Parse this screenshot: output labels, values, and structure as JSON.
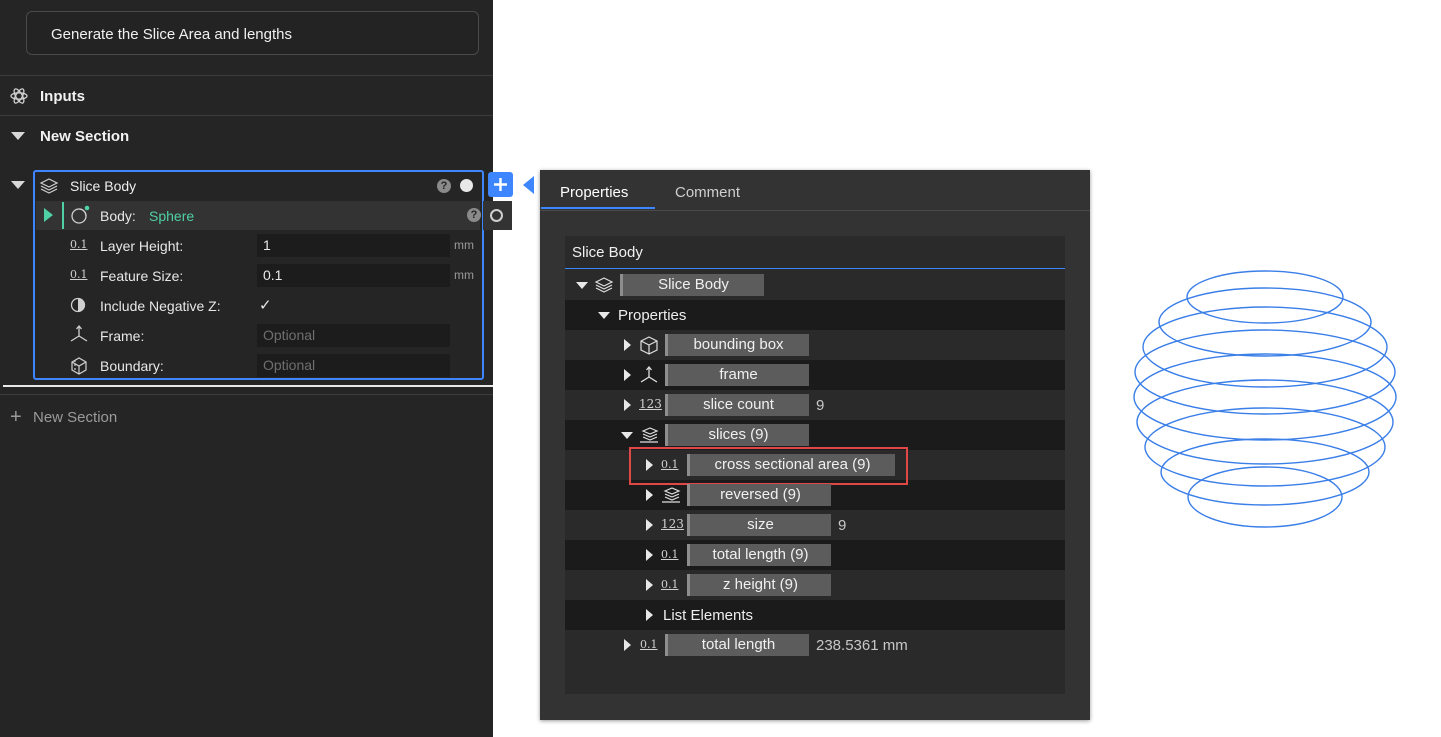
{
  "left_panel": {
    "task_title": "Generate the Slice Area and lengths",
    "inputs_label": "Inputs",
    "section_label": "New Section",
    "add_section_label": "New Section",
    "node": {
      "title": "Slice Body",
      "body_label": "Body:",
      "body_value": "Sphere",
      "fields": [
        {
          "label": "Layer Height:",
          "value": "1",
          "unit": "mm"
        },
        {
          "label": "Feature Size:",
          "value": "0.1",
          "unit": "mm"
        },
        {
          "label": "Include Negative Z:",
          "checked": true
        },
        {
          "label": "Frame:",
          "placeholder": "Optional"
        },
        {
          "label": "Boundary:",
          "placeholder": "Optional"
        }
      ],
      "help_glyph": "?",
      "checkmark": "✓"
    }
  },
  "properties_panel": {
    "tabs": [
      {
        "label": "Properties",
        "active": true
      },
      {
        "label": "Comment",
        "active": false
      }
    ],
    "header": "Slice Body",
    "tree": {
      "root": "Slice Body",
      "properties_label": "Properties",
      "items": [
        {
          "label": "bounding box",
          "value": ""
        },
        {
          "label": "frame",
          "value": ""
        },
        {
          "label": "slice count",
          "value": "9"
        },
        {
          "label": "slices (9)",
          "value": ""
        }
      ],
      "sub_items": [
        {
          "label": "cross sectional area (9)",
          "value": "",
          "highlighted": true
        },
        {
          "label": "reversed (9)",
          "value": ""
        },
        {
          "label": "size",
          "value": "9"
        },
        {
          "label": "total length (9)",
          "value": ""
        },
        {
          "label": "z height (9)",
          "value": ""
        }
      ],
      "list_elements_label": "List Elements",
      "total_length": {
        "label": "total length",
        "value": "238.5361 mm"
      }
    }
  },
  "icons": {
    "decimal": "0.1",
    "integer": "123"
  },
  "colors": {
    "accent": "#3d86ff",
    "body_value": "#4fd1a5",
    "highlight_box": "#e04848",
    "sphere_wire": "#3a7ee8"
  }
}
